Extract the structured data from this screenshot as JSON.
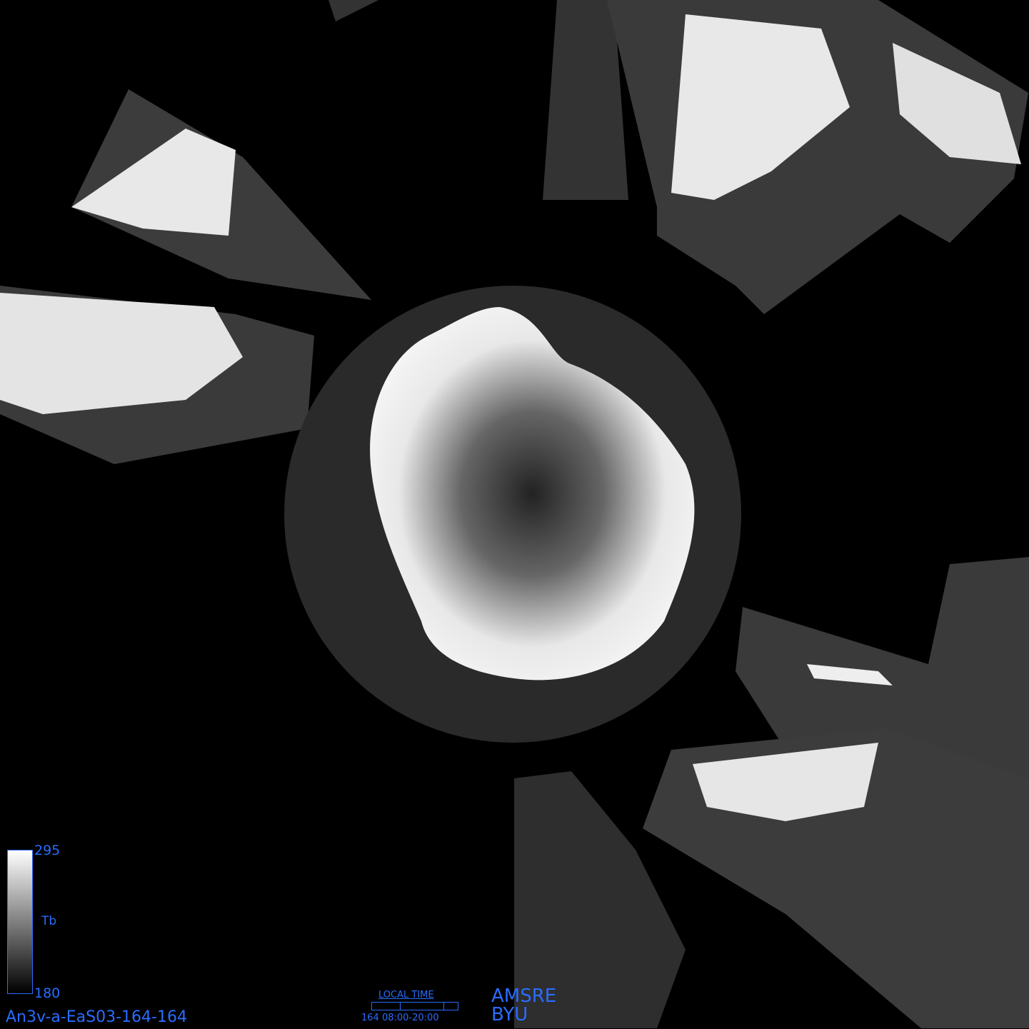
{
  "map": {
    "background_color": "#000000",
    "content": "Antarctic polar stereographic brightness temperature mosaic (AMSR-E swaths)"
  },
  "colorbar": {
    "max": "295",
    "min": "180",
    "variable": "Tb",
    "gradient": [
      "#ffffff",
      "#000000"
    ],
    "border_color": "#2a6cff"
  },
  "file_id": "An3v-a-EaS03-164-164",
  "local_time": {
    "title": "LOCAL TIME",
    "range": "164 08:00-20:00"
  },
  "sensor": "AMSRE",
  "org": "BYU",
  "label_color": "#2a6cff"
}
